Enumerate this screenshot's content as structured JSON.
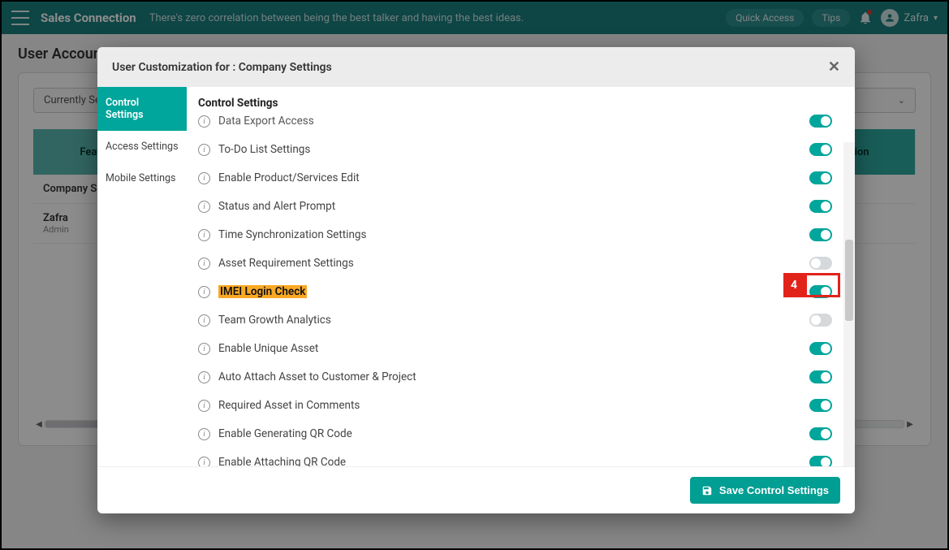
{
  "topbar": {
    "brand": "Sales Connection",
    "tagline": "There's zero correlation between being the best talker and having the best ideas.",
    "quick_access": "Quick Access",
    "tips": "Tips",
    "user_name": "Zafra"
  },
  "page": {
    "title": "User Account Customisation",
    "selector_label": "Currently Selected",
    "table": {
      "cols": [
        "Feature",
        "",
        "ection"
      ],
      "row1_label": "Company Settings",
      "row2_name": "Zafra",
      "row2_role": "Admin"
    }
  },
  "modal": {
    "title": "User Customization for : Company Settings",
    "tabs": [
      "Control Settings",
      "Access Settings",
      "Mobile Settings"
    ],
    "active_tab": 0,
    "pane_title": "Control Settings",
    "settings": [
      {
        "label": "Data Export Access",
        "on": true,
        "cut": true
      },
      {
        "label": "To-Do List Settings",
        "on": true
      },
      {
        "label": "Enable Product/Services Edit",
        "on": true
      },
      {
        "label": "Status and Alert Prompt",
        "on": true
      },
      {
        "label": "Time Synchronization Settings",
        "on": true
      },
      {
        "label": "Asset Requirement Settings",
        "on": false
      },
      {
        "label": "IMEI Login Check",
        "on": true,
        "highlight": true
      },
      {
        "label": "Team Growth Analytics",
        "on": false
      },
      {
        "label": "Enable Unique Asset",
        "on": true
      },
      {
        "label": "Auto Attach Asset to Customer & Project",
        "on": true
      },
      {
        "label": "Required Asset in Comments",
        "on": true
      },
      {
        "label": "Enable Generating QR Code",
        "on": true
      },
      {
        "label": "Enable Attaching QR Code",
        "on": true,
        "cut_bottom": true
      }
    ],
    "save_label": "Save Control Settings"
  },
  "callout": {
    "number": "4"
  }
}
